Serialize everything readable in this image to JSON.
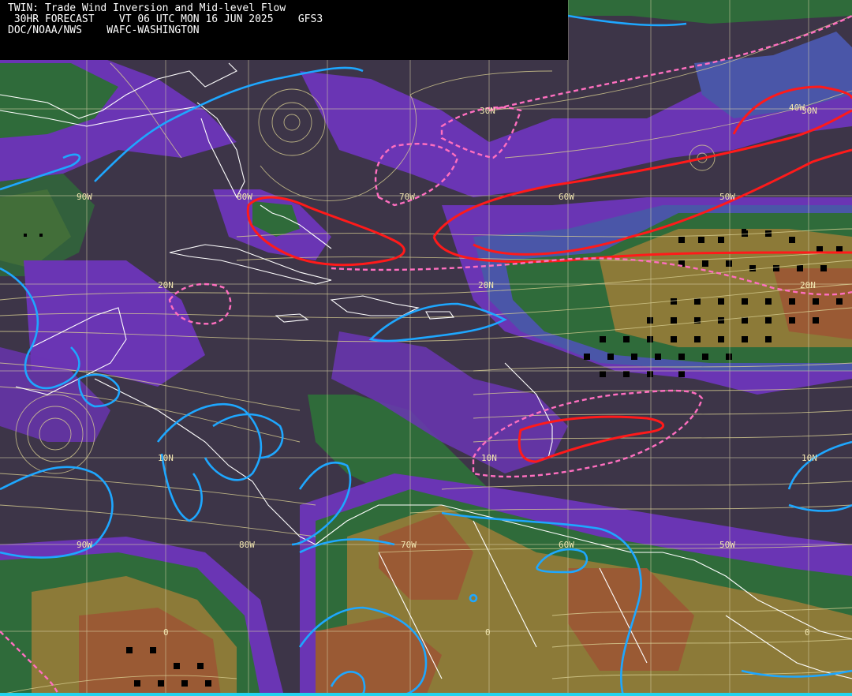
{
  "header": {
    "line1": "TWIN: Trade Wind Inversion and Mid-level Flow",
    "line2": " 30HR FORECAST    VT 06 UTC MON 16 JUN 2025    GFS3",
    "line3": "DOC/NOAA/NWS    WAFC-WASHINGTON"
  },
  "lat_labels": [
    "30N",
    "20N",
    "10N",
    "0"
  ],
  "lon_labels": [
    "90W",
    "80W",
    "70W",
    "60W",
    "50W",
    "40W"
  ],
  "colors": {
    "background": "#3d3548",
    "purple_band": "#6a35b4",
    "blue_band": "#4a56a8",
    "green_band": "#2f6b3a",
    "olive_band": "#8c7a38",
    "brown_band": "#9a5a34",
    "streamline": "#d9cf92",
    "coast": "#ffffff",
    "cyan_contour": "#1ea7ff",
    "red_contour": "#ff1a1a",
    "pink_dashed": "#ff6fc0",
    "grid": "#d8d2a8"
  }
}
